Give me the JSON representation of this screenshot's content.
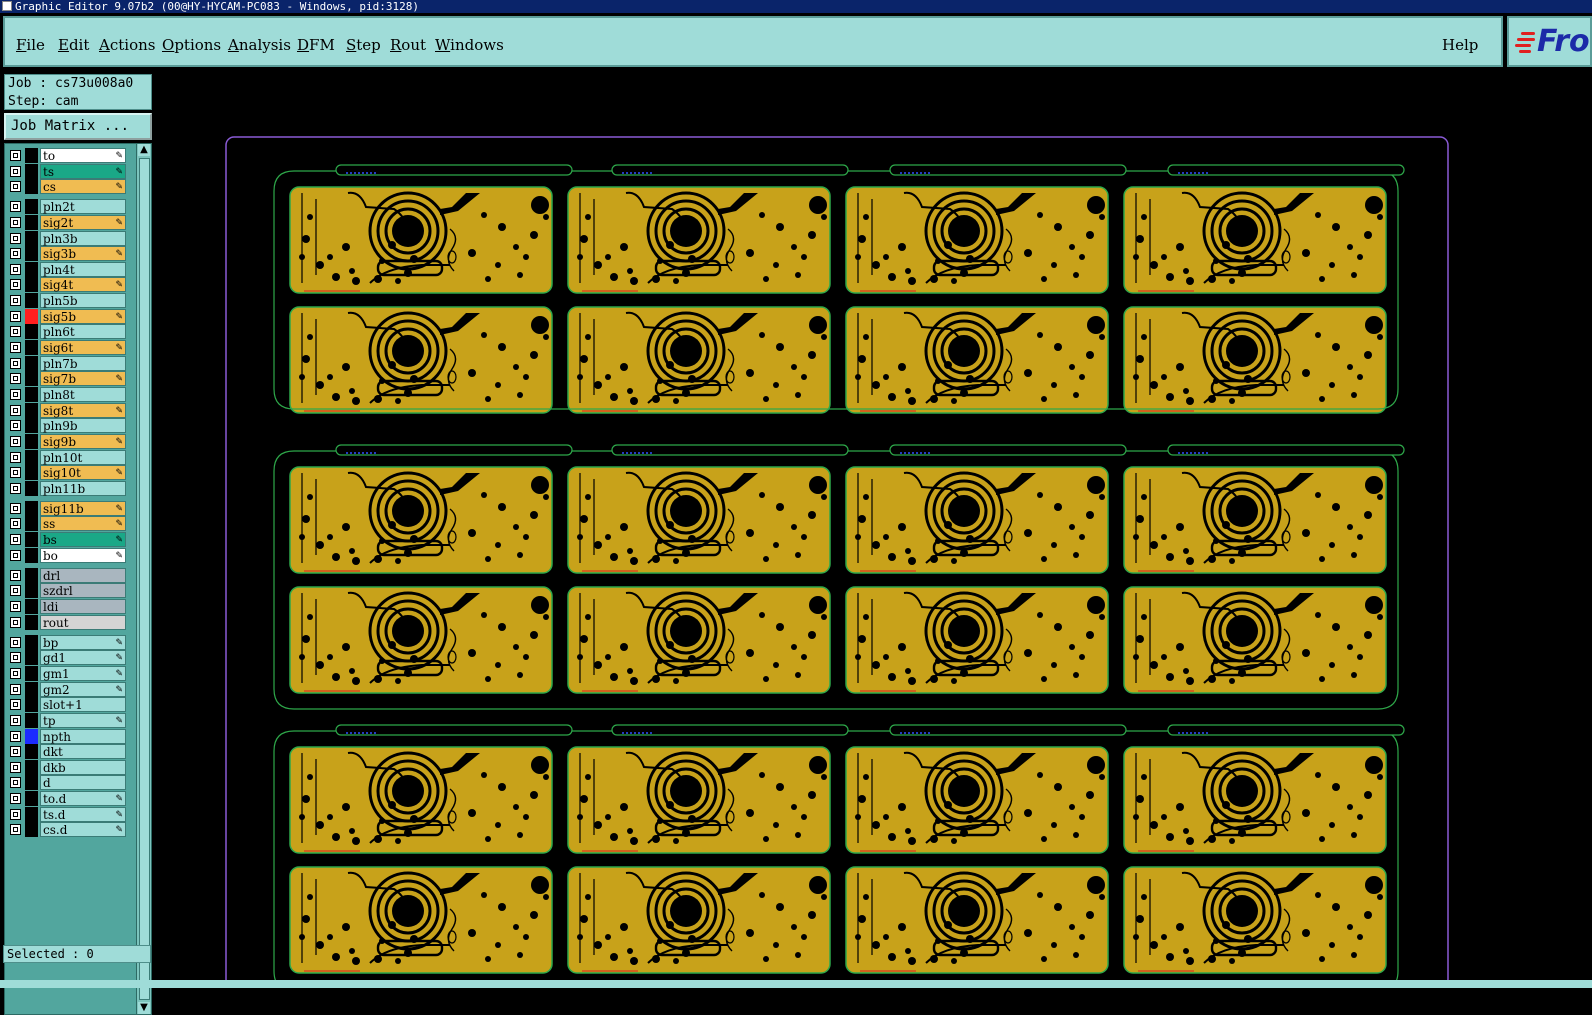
{
  "window": {
    "title": "Graphic Editor 9.07b2 (00@HY-HYCAM-PC083 - Windows, pid:3128)"
  },
  "menu": {
    "items": [
      {
        "label": "File",
        "key": "F",
        "rest": "ile"
      },
      {
        "label": "Edit",
        "key": "E",
        "rest": "dit"
      },
      {
        "label": "Actions",
        "key": "A",
        "rest": "ctions"
      },
      {
        "label": "Options",
        "key": "O",
        "rest": "ptions"
      },
      {
        "label": "Analysis",
        "key": "A",
        "rest": "nalysis"
      },
      {
        "label": "DFM",
        "key": "D",
        "rest": "FM"
      },
      {
        "label": "Step",
        "key": "S",
        "rest": "tep"
      },
      {
        "label": "Rout",
        "key": "R",
        "rest": "out"
      },
      {
        "label": "Windows",
        "key": "W",
        "rest": "indows"
      }
    ],
    "help": "Help",
    "logo_text": "Fron"
  },
  "job": {
    "job_line": "Job : cs73u008a0",
    "step_line": "Step: cam",
    "matrix_button": "Job Matrix ..."
  },
  "layers": [
    {
      "name": "to",
      "bg": "#ffffff",
      "editable": true
    },
    {
      "name": "ts",
      "bg": "#1aa887",
      "editable": true
    },
    {
      "name": "cs",
      "bg": "#f0bc52",
      "editable": true
    },
    {
      "name": "pln2t",
      "bg": "#9fdcd8",
      "editable": false,
      "gap": true
    },
    {
      "name": "sig2t",
      "bg": "#f0bc52",
      "editable": true
    },
    {
      "name": "pln3b",
      "bg": "#9fdcd8",
      "editable": false
    },
    {
      "name": "sig3b",
      "bg": "#f0bc52",
      "editable": true
    },
    {
      "name": "pln4t",
      "bg": "#9fdcd8",
      "editable": false
    },
    {
      "name": "sig4t",
      "bg": "#f0bc52",
      "editable": true
    },
    {
      "name": "pln5b",
      "bg": "#9fdcd8",
      "editable": false
    },
    {
      "name": "sig5b",
      "bg": "#f0bc52",
      "editable": true,
      "mark": "#ff2020"
    },
    {
      "name": "pln6t",
      "bg": "#9fdcd8",
      "editable": false
    },
    {
      "name": "sig6t",
      "bg": "#f0bc52",
      "editable": true
    },
    {
      "name": "pln7b",
      "bg": "#9fdcd8",
      "editable": false
    },
    {
      "name": "sig7b",
      "bg": "#f0bc52",
      "editable": true
    },
    {
      "name": "pln8t",
      "bg": "#9fdcd8",
      "editable": false
    },
    {
      "name": "sig8t",
      "bg": "#f0bc52",
      "editable": true
    },
    {
      "name": "pln9b",
      "bg": "#9fdcd8",
      "editable": false
    },
    {
      "name": "sig9b",
      "bg": "#f0bc52",
      "editable": true
    },
    {
      "name": "pln10t",
      "bg": "#9fdcd8",
      "editable": false
    },
    {
      "name": "sig10t",
      "bg": "#f0bc52",
      "editable": true
    },
    {
      "name": "pln11b",
      "bg": "#9fdcd8",
      "editable": false
    },
    {
      "name": "sig11b",
      "bg": "#f0bc52",
      "editable": true,
      "gap": true
    },
    {
      "name": "ss",
      "bg": "#f0bc52",
      "editable": true
    },
    {
      "name": "bs",
      "bg": "#1aa887",
      "editable": true
    },
    {
      "name": "bo",
      "bg": "#ffffff",
      "editable": true
    },
    {
      "name": "drl",
      "bg": "#a9b6bf",
      "editable": false,
      "gap": true
    },
    {
      "name": "szdrl",
      "bg": "#a9b6bf",
      "editable": false
    },
    {
      "name": "ldi",
      "bg": "#a9b6bf",
      "editable": false
    },
    {
      "name": "rout",
      "bg": "#d4d4d4",
      "editable": false
    },
    {
      "name": "bp",
      "bg": "#9fdcd8",
      "editable": true,
      "gap": true
    },
    {
      "name": "gd1",
      "bg": "#9fdcd8",
      "editable": true
    },
    {
      "name": "gm1",
      "bg": "#9fdcd8",
      "editable": true
    },
    {
      "name": "gm2",
      "bg": "#9fdcd8",
      "editable": true
    },
    {
      "name": "slot+1",
      "bg": "#9fdcd8",
      "editable": false
    },
    {
      "name": "tp",
      "bg": "#9fdcd8",
      "editable": true
    },
    {
      "name": "npth",
      "bg": "#9fdcd8",
      "editable": false,
      "mark": "#1c2cff"
    },
    {
      "name": "dkt",
      "bg": "#9fdcd8",
      "editable": false
    },
    {
      "name": "dkb",
      "bg": "#9fdcd8",
      "editable": false
    },
    {
      "name": "d",
      "bg": "#9fdcd8",
      "editable": false
    },
    {
      "name": "to.d",
      "bg": "#9fdcd8",
      "editable": true
    },
    {
      "name": "ts.d",
      "bg": "#9fdcd8",
      "editable": true
    },
    {
      "name": "cs.d",
      "bg": "#9fdcd8",
      "editable": true
    }
  ],
  "status": {
    "selected": "Selected : 0"
  },
  "icons": {
    "edit_indicator": "pencil-icon",
    "scroll_up": "arrow-up-icon",
    "scroll_down": "arrow-down-icon"
  },
  "colors": {
    "copper": "#c8a21a",
    "outline": "#2ea84a",
    "panel_border": "#8a5bd6",
    "drill": "#000000"
  }
}
